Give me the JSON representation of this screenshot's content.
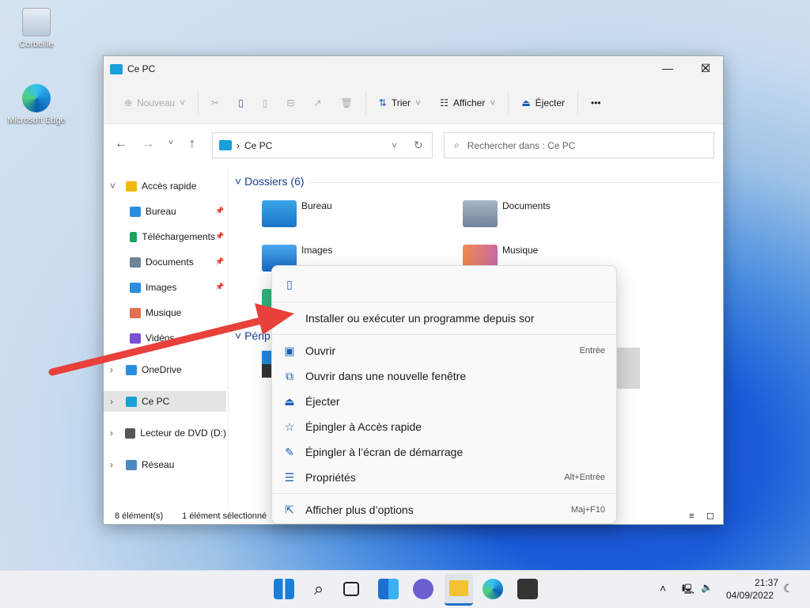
{
  "desktop": {
    "icons": [
      {
        "label": "Corbeille",
        "icon": "recycle-bin-icon"
      },
      {
        "label": "Microsoft Edge",
        "icon": "edge-icon"
      }
    ]
  },
  "window": {
    "title": "Ce PC",
    "controls": [
      "minimize",
      "maximize",
      "close"
    ]
  },
  "toolbar": {
    "new_label": "Nouveau",
    "sort_label": "Trier",
    "view_label": "Afficher",
    "eject_label": "Éjecter",
    "more_label": "•••"
  },
  "address": {
    "path": "Ce PC",
    "search_placeholder": "Rechercher dans : Ce PC"
  },
  "sidebar": {
    "items": [
      {
        "label": "Accès rapide",
        "icon": "star-icon"
      },
      {
        "label": "Bureau",
        "icon": "desktop-folder-icon",
        "pinned": true
      },
      {
        "label": "Téléchargements",
        "icon": "download-icon",
        "pinned": true
      },
      {
        "label": "Documents",
        "icon": "documents-icon",
        "pinned": true
      },
      {
        "label": "Images",
        "icon": "images-icon",
        "pinned": true
      },
      {
        "label": "Musique",
        "icon": "music-icon"
      },
      {
        "label": "Vidéos",
        "icon": "videos-icon"
      },
      {
        "label": "OneDrive",
        "icon": "cloud-icon"
      },
      {
        "label": "Ce PC",
        "icon": "pc-icon",
        "selected": true
      },
      {
        "label": "Lecteur de DVD (D:)",
        "icon": "dvd-icon"
      },
      {
        "label": "Réseau",
        "icon": "network-icon"
      }
    ]
  },
  "content": {
    "folders_header": "Dossiers (6)",
    "devices_header": "Périp",
    "folders": [
      {
        "label": "Bureau"
      },
      {
        "label": "Documents"
      },
      {
        "label": "Images"
      },
      {
        "label": "Musique"
      }
    ]
  },
  "status": {
    "count": "8 élément(s)",
    "selection": "1 élément sélectionné"
  },
  "context_menu": {
    "items": [
      {
        "label": "Installer ou exécuter un programme depuis sor",
        "shortcut": ""
      },
      {
        "label": "Ouvrir",
        "shortcut": "Entrée",
        "icon": "open-icon"
      },
      {
        "label": "Ouvrir dans une nouvelle fenêtre",
        "shortcut": "",
        "icon": "new-window-icon"
      },
      {
        "label": "Éjecter",
        "shortcut": "",
        "icon": "eject-icon"
      },
      {
        "label": "Épingler à Accès rapide",
        "shortcut": "",
        "icon": "star-icon"
      },
      {
        "label": "Épingler à l’écran de démarrage",
        "shortcut": "",
        "icon": "pin-icon"
      },
      {
        "label": "Propriétés",
        "shortcut": "Alt+Entrée",
        "icon": "properties-icon"
      },
      {
        "label": "Afficher plus d’options",
        "shortcut": "Maj+F10",
        "icon": "more-options-icon"
      }
    ]
  },
  "taskbar": {
    "time": "21:37",
    "date": "04/09/2022"
  },
  "colors": {
    "accent": "#0067c0",
    "arrow": "#e8403a",
    "taskbar": "#eef0f4"
  }
}
